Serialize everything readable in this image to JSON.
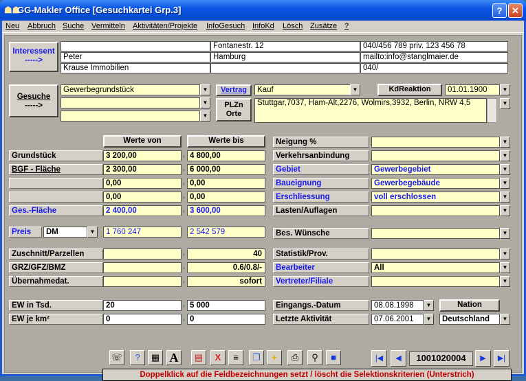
{
  "window": {
    "title": "GG-Makler Office [Gesuchkartei Grp.3]",
    "help": "?",
    "close": "✕"
  },
  "menu": [
    "Neu",
    "Abbruch",
    "Suche",
    "Vermitteln",
    "Aktivitäten/Projekte",
    "InfoGesuch",
    "InfoKd",
    "Lösch",
    "Zusätze",
    "?"
  ],
  "interessent": {
    "button": "Interessent",
    "arrow": "----->",
    "lines": [
      "",
      "Peter",
      "Krause Immobilien"
    ],
    "address": [
      "Fontanestr. 12",
      "Hamburg",
      ""
    ],
    "contact": [
      "040/456 789   priv. 123 456 78",
      "mailto:info@stanglmaier.de",
      "040/"
    ]
  },
  "gesuche": {
    "button": "Gesuche",
    "arrow": "----->",
    "object1": "Gewerbegrundstück",
    "object2": "",
    "object3": "",
    "vertrag_label": "Vertrag",
    "vertrag_value": "Kauf",
    "kdreaktion_label": "KdReaktion",
    "kdreaktion_value": "01.01.1900",
    "plzn_label": "PLZn Orte",
    "plzn_value": "Stuttgar,7037, Ham-Alt,2276, Wolmirs,3932, Berlin, NRW 4,5"
  },
  "werte": {
    "von_header": "Werte von",
    "bis_header": "Werte bis",
    "rows": [
      {
        "label": "Grundstück",
        "von": "3 200,00",
        "bis": "4 800,00",
        "blue": false
      },
      {
        "label": "BGF - Fläche",
        "von": "2 300,00",
        "bis": "6 000,00",
        "blue": false
      },
      {
        "label": "",
        "von": "0,00",
        "bis": "0,00",
        "blue": false
      },
      {
        "label": "",
        "von": "0,00",
        "bis": "0,00",
        "blue": false
      },
      {
        "label": "Ges.-Fläche",
        "von": "2 400,00",
        "bis": "3 600,00",
        "blue": true
      }
    ]
  },
  "preis": {
    "label": "Preis",
    "currency": "DM",
    "von": "1 760 247",
    "bis": "2 542 579"
  },
  "extra": [
    {
      "label": "Zuschnitt/Parzellen",
      "von": "",
      "bis": "40"
    },
    {
      "label": "GRZ/GFZ/BMZ",
      "von": "",
      "bis": "0.6/0.8/-"
    },
    {
      "label": "Übernahmedat.",
      "von": "",
      "bis": "sofort"
    }
  ],
  "ew": [
    {
      "label": "EW in Tsd.",
      "von": "20",
      "bis": "5 000"
    },
    {
      "label": "EW je km²",
      "von": "0",
      "bis": "0"
    }
  ],
  "right": [
    {
      "label": "Neigung %",
      "value": "",
      "blue": false
    },
    {
      "label": "Verkehrsanbindung",
      "value": "",
      "blue": false
    },
    {
      "label": "Gebiet",
      "value": "Gewerbegebiet",
      "blue": true
    },
    {
      "label": "Baueignung",
      "value": "Gewerbegebäude",
      "blue": true
    },
    {
      "label": "Erschliessung",
      "value": "voll erschlossen",
      "blue": true
    },
    {
      "label": "Lasten/Auflagen",
      "value": "",
      "blue": false
    }
  ],
  "wuensche": {
    "label": "Bes. Wünsche",
    "value": ""
  },
  "right2": [
    {
      "label": "Statistik/Prov.",
      "value": "",
      "blue": false
    },
    {
      "label": "Bearbeiter",
      "value": "All",
      "blue": true
    },
    {
      "label": "Vertreter/Filiale",
      "value": "",
      "blue": true
    }
  ],
  "dates": {
    "eingang_label": "Eingangs.-Datum",
    "eingang_value": "08.08.1998",
    "aktiv_label": "Letzte Aktivität",
    "aktiv_value": "07.06.2001",
    "nation_label": "Nation",
    "nation_value": "Deutschland"
  },
  "toolbar": [
    "fax-icon",
    "help-icon",
    "calculator-icon",
    "A",
    "chart-icon",
    "X",
    "list-icon",
    "copy-icon",
    "+",
    "print-icon",
    "search-icon",
    "save-icon"
  ],
  "nav": {
    "first": "|◀",
    "prev": "◀",
    "record": "1001020004",
    "next": "▶",
    "last": "▶|"
  },
  "status": "Doppelklick auf die Feldbezeichnungen setzt / löscht die Selektionskriterien (Unterstrich)"
}
